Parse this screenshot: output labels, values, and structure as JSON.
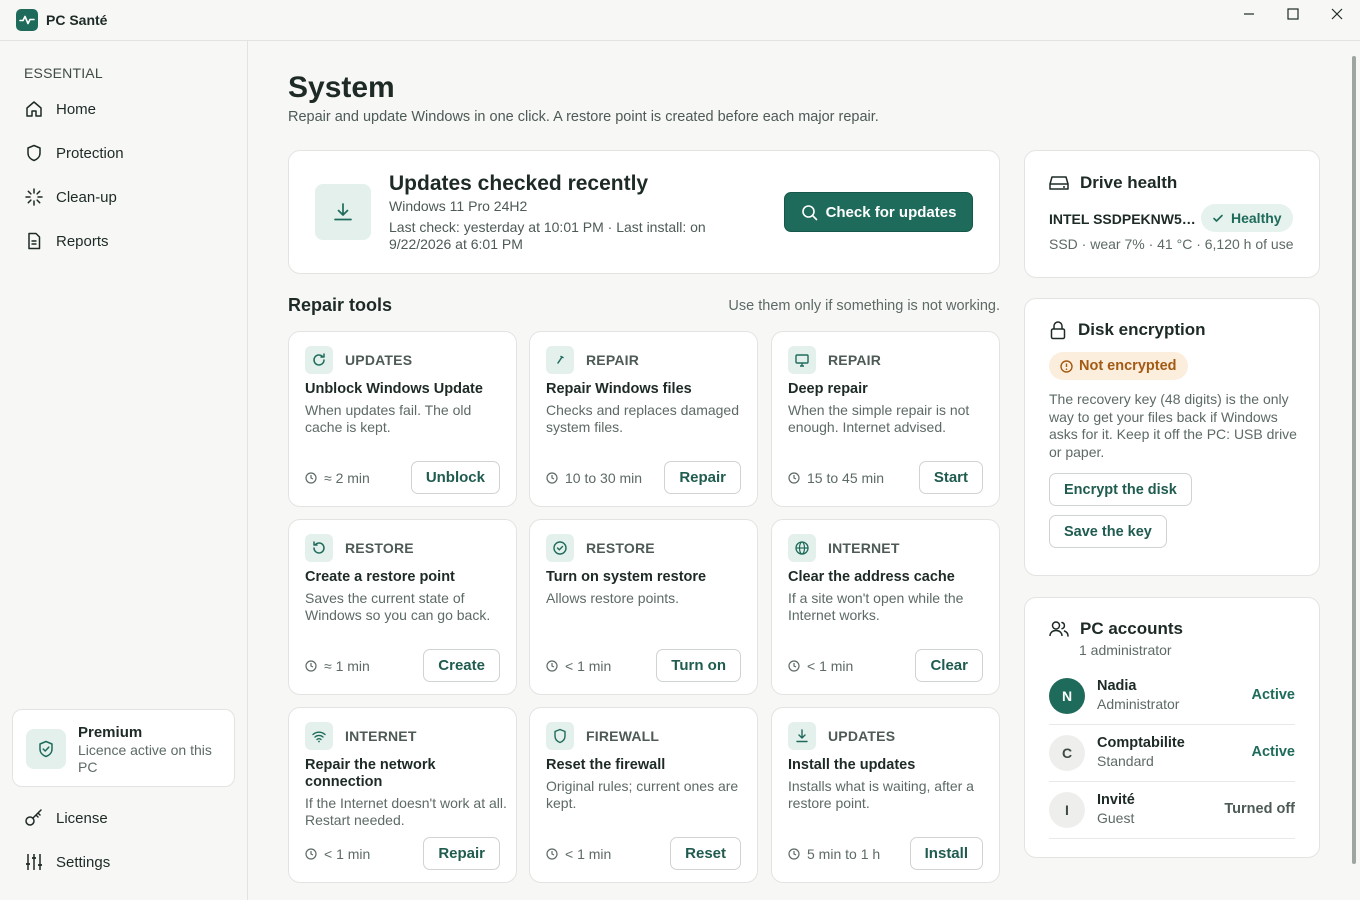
{
  "app": {
    "title": "PC Santé",
    "icons": {
      "logo": "pulse-icon",
      "minimize": "minimize-icon",
      "maximize": "maximize-icon",
      "close": "close-icon"
    }
  },
  "sidebar": {
    "section": "ESSENTIAL",
    "items": [
      {
        "label": "Home",
        "icon": "home-icon"
      },
      {
        "label": "Protection",
        "icon": "shield-icon"
      },
      {
        "label": "Clean-up",
        "icon": "sparkle-icon"
      },
      {
        "label": "Reports",
        "icon": "document-icon"
      }
    ],
    "premium": {
      "title": "Premium",
      "subtitle": "Licence active on this PC",
      "icon": "shield-check-icon"
    },
    "bottom": [
      {
        "label": "License",
        "icon": "key-icon"
      },
      {
        "label": "Settings",
        "icon": "sliders-icon"
      }
    ]
  },
  "page": {
    "title": "System",
    "subtitle": "Repair and update Windows in one click. A restore point is created before each major repair."
  },
  "updates": {
    "title": "Updates checked recently",
    "os": "Windows 11 Pro 24H2",
    "last": "Last check: yesterday at 10:01 PM · Last install: on 9/22/2026 at 6:01 PM",
    "button": "Check for updates",
    "icon": "download-icon"
  },
  "repair": {
    "title": "Repair tools",
    "hint": "Use them only if something is not working.",
    "tools": [
      {
        "category": "UPDATES",
        "icon": "refresh-icon",
        "name": "Unblock Windows Update",
        "desc": "When updates fail. The old cache is kept.",
        "duration": "≈ 2 min",
        "button": "Unblock"
      },
      {
        "category": "REPAIR",
        "icon": "wrench-icon",
        "name": "Repair Windows files",
        "desc": "Checks and replaces damaged system files.",
        "duration": "10 to 30 min",
        "button": "Repair"
      },
      {
        "category": "REPAIR",
        "icon": "monitor-icon",
        "name": "Deep repair",
        "desc": "When the simple repair is not enough. Internet advised.",
        "duration": "15 to 45 min",
        "button": "Start"
      },
      {
        "category": "RESTORE",
        "icon": "restore-icon",
        "name": "Create a restore point",
        "desc": "Saves the current state of Windows so you can go back.",
        "duration": "≈ 1 min",
        "button": "Create"
      },
      {
        "category": "RESTORE",
        "icon": "check-circle-icon",
        "name": "Turn on system restore",
        "desc": "Allows restore points.",
        "duration": "< 1 min",
        "button": "Turn on"
      },
      {
        "category": "INTERNET",
        "icon": "globe-icon",
        "name": "Clear the address cache",
        "desc": "If a site won't open while the Internet works.",
        "duration": "< 1 min",
        "button": "Clear"
      },
      {
        "category": "INTERNET",
        "icon": "wifi-icon",
        "name": "Repair the network connection",
        "desc": "If the Internet doesn't work at all. Restart needed.",
        "duration": "< 1 min",
        "button": "Repair"
      },
      {
        "category": "FIREWALL",
        "icon": "shield-icon",
        "name": "Reset the firewall",
        "desc": "Original rules; current ones are kept.",
        "duration": "< 1 min",
        "button": "Reset"
      },
      {
        "category": "UPDATES",
        "icon": "download-icon",
        "name": "Install the updates",
        "desc": "Installs what is waiting, after a restore point.",
        "duration": "5 min to 1 h",
        "button": "Install"
      }
    ]
  },
  "drive": {
    "title": "Drive health",
    "name": "INTEL SSDPEKNW5…",
    "badge": "Healthy",
    "stats": "SSD · wear 7% · 41 °C · 6,120 h of use",
    "icon": "drive-icon"
  },
  "encryption": {
    "title": "Disk encryption",
    "badge": "Not encrypted",
    "text": "The recovery key (48 digits) is the only way to get your files back if Windows asks for it. Keep it off the PC: USB drive or paper.",
    "encrypt_button": "Encrypt the disk",
    "save_button": "Save the key",
    "icon": "lock-icon"
  },
  "accounts": {
    "title": "PC accounts",
    "subtitle": "1 administrator",
    "icon": "users-icon",
    "list": [
      {
        "initial": "N",
        "name": "Nadia",
        "role": "Administrator",
        "status": "Active"
      },
      {
        "initial": "C",
        "name": "Comptabilite",
        "role": "Standard",
        "status": "Active"
      },
      {
        "initial": "I",
        "name": "Invité",
        "role": "Guest",
        "status": "Turned off"
      }
    ]
  },
  "colors": {
    "accent": "#1f6b5b",
    "accent_light": "#e3f0ec",
    "warning": "#a35a12",
    "warning_bg": "#fbeedd"
  }
}
